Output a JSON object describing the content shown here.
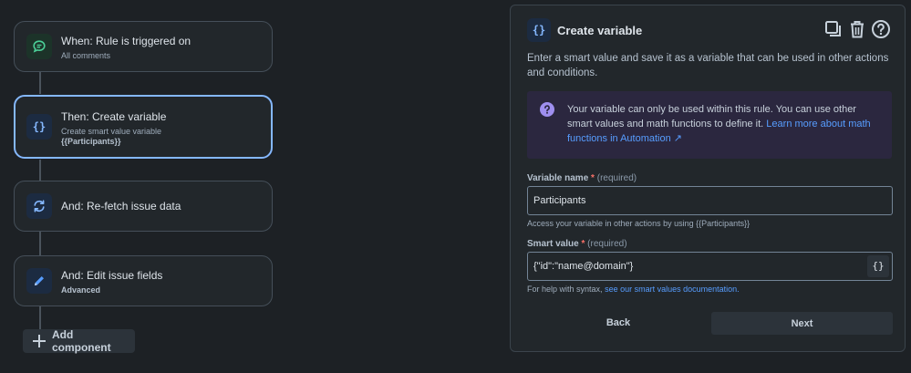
{
  "flow": {
    "steps": [
      {
        "title": "When: Rule is triggered on",
        "subtitle": "All comments",
        "icon": "comment-trigger-icon",
        "color": "#4bce97"
      },
      {
        "title": "Then: Create variable",
        "subtitle": "Create smart value variable",
        "subtitle2": "{{Participants}}",
        "icon": "curly-braces-icon",
        "color": "#85b8ff"
      },
      {
        "title": "And: Re-fetch issue data",
        "icon": "refresh-icon",
        "color": "#85b8ff"
      },
      {
        "title": "And: Edit issue fields",
        "subtitle": "Advanced",
        "icon": "pencil-icon",
        "color": "#579dff"
      }
    ],
    "add_component_label": "Add component"
  },
  "panel": {
    "icon_text": "{}",
    "title": "Create variable",
    "description": "Enter a smart value and save it as a variable that can be used in other actions and conditions.",
    "info": {
      "text": "Your variable can only be used within this rule. You can use other smart values and math functions to define it.",
      "link_text": "Learn more about math functions in Automation ↗"
    },
    "variable_name": {
      "label": "Variable name",
      "required_marker": "*",
      "required_text": "(required)",
      "value": "Participants",
      "helper": "Access your variable in other actions by using {{Participants}}"
    },
    "smart_value": {
      "label": "Smart value",
      "required_marker": "*",
      "required_text": "(required)",
      "value": "{\"id\":\"name@domain\"}",
      "button_text": "{}",
      "helper_text": "For help with syntax,",
      "helper_link": "see our smart values documentation."
    },
    "back_label": "Back",
    "next_label": "Next"
  },
  "colors": {
    "background": "#1d2125",
    "card": "#22272b",
    "selected_border": "#85b8ff",
    "link": "#579dff",
    "info_background": "#2b273f",
    "info_icon": "#9f8fef",
    "required": "#f87168"
  }
}
